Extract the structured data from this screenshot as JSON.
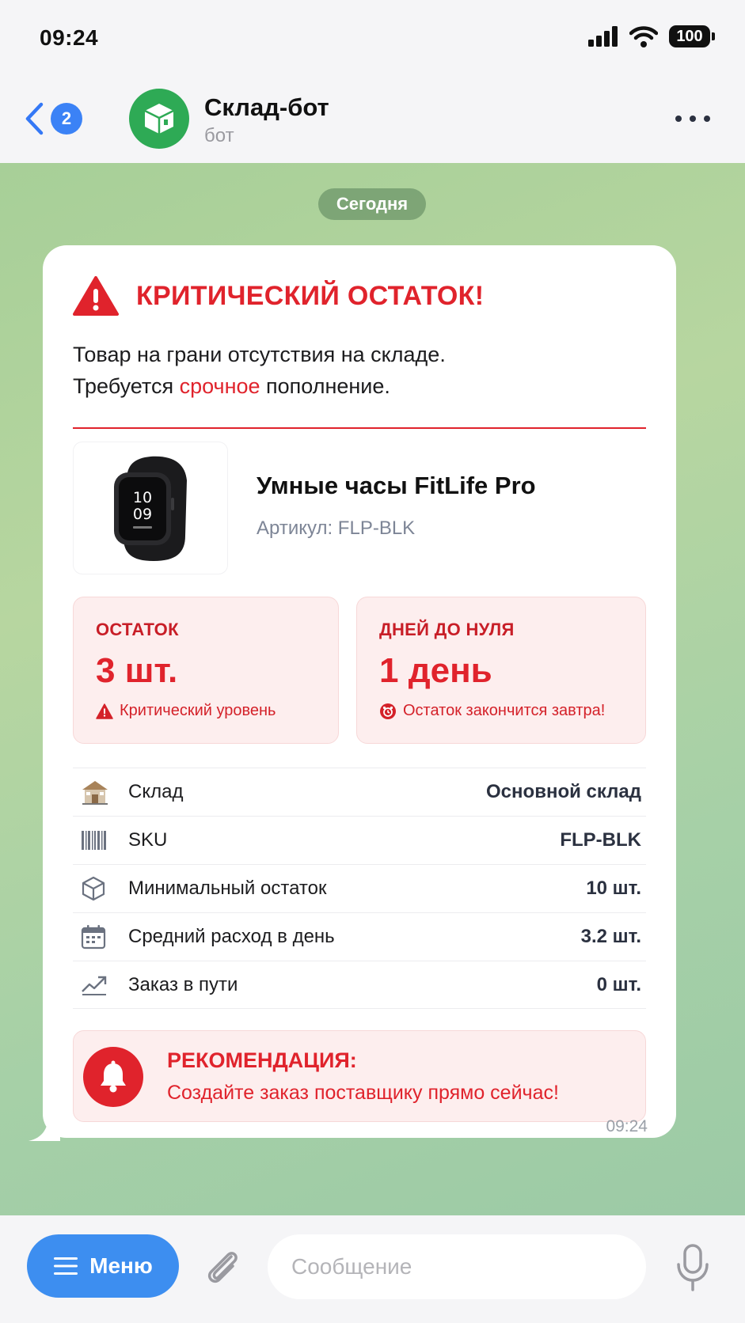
{
  "status_bar": {
    "time": "09:24",
    "battery": "100"
  },
  "header": {
    "back_badge": "2",
    "title": "Склад-бот",
    "subtitle": "бот"
  },
  "chat": {
    "date_label": "Сегодня"
  },
  "message": {
    "alert_title": "КРИТИЧЕСКИЙ ОСТАТОК!",
    "alert_line1": "Товар на грани отсутствия на складе.",
    "alert_line2_pre": "Требуется ",
    "alert_line2_urgent": "срочное",
    "alert_line2_post": " пополнение.",
    "product": {
      "name": "Умные часы FitLife Pro",
      "sku_line": "Артикул: FLP-BLK",
      "watch_time_hours": "10",
      "watch_time_minutes": "09"
    },
    "stats": [
      {
        "label": "ОСТАТОК",
        "value": "3 шт.",
        "note": "Критический уровень"
      },
      {
        "label": "ДНЕЙ ДО НУЛЯ",
        "value": "1 день",
        "note": "Остаток закончится завтра!"
      }
    ],
    "details": [
      {
        "icon": "warehouse-icon",
        "label": "Склад",
        "value": "Основной склад"
      },
      {
        "icon": "barcode-icon",
        "label": "SKU",
        "value": "FLP-BLK"
      },
      {
        "icon": "box-icon",
        "label": "Минимальный остаток",
        "value": "10 шт."
      },
      {
        "icon": "calendar-icon",
        "label": "Средний расход в день",
        "value": "3.2 шт."
      },
      {
        "icon": "trend-icon",
        "label": "Заказ в пути",
        "value": "0 шт."
      }
    ],
    "recommendation": {
      "title": "РЕКОМЕНДАЦИЯ:",
      "text": "Создайте заказ поставщику прямо сейчас!"
    },
    "time": "09:24"
  },
  "composer": {
    "menu_label": "Меню",
    "placeholder": "Сообщение"
  },
  "colors": {
    "accent_red": "#e0232c",
    "accent_blue": "#3d8ef0",
    "bot_green": "#2eaa55"
  }
}
